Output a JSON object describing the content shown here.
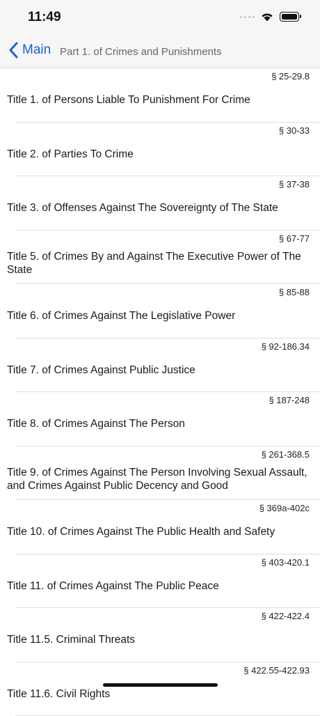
{
  "status": {
    "time": "11:49"
  },
  "nav": {
    "back_label": "Main",
    "title": "Part 1.  of Crimes and Punishments"
  },
  "titles": [
    {
      "ref": "§ 25-29.8",
      "label": "Title 1.  of Persons Liable To Punishment For Crime"
    },
    {
      "ref": "§ 30-33",
      "label": "Title 2.  of Parties To Crime"
    },
    {
      "ref": "§ 37-38",
      "label": "Title 3.  of Offenses Against The Sovereignty of The State"
    },
    {
      "ref": "§ 67-77",
      "label": "Title 5.  of Crimes By and Against The Executive Power of The State"
    },
    {
      "ref": "§ 85-88",
      "label": "Title 6.  of Crimes Against The Legislative Power"
    },
    {
      "ref": "§ 92-186.34",
      "label": "Title 7.  of Crimes Against Public Justice"
    },
    {
      "ref": "§ 187-248",
      "label": "Title 8.  of Crimes Against The Person"
    },
    {
      "ref": "§ 261-368.5",
      "label": "Title 9.  of Crimes Against The Person Involving Sexual Assault, and Crimes Against Public Decency and Good"
    },
    {
      "ref": "§ 369a-402c",
      "label": "Title 10.  of Crimes Against The Public Health and Safety"
    },
    {
      "ref": "§ 403-420.1",
      "label": "Title 11.  of Crimes Against The Public Peace"
    },
    {
      "ref": "§ 422-422.4",
      "label": "Title 11.5.  Criminal Threats"
    },
    {
      "ref": "§ 422.55-422.93",
      "label": "Title 11.6.  Civil Rights"
    }
  ]
}
